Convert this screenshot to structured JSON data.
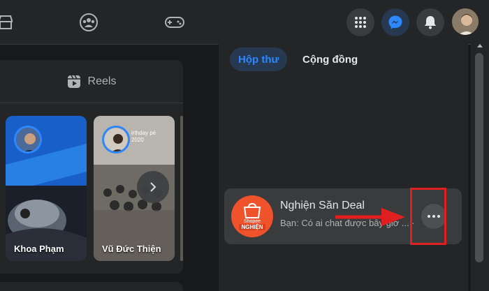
{
  "topbar": {
    "nav_icons": [
      "store-icon",
      "groups-icon",
      "gaming-icon"
    ],
    "right_buttons": [
      "menu-grid-icon",
      "messenger-icon",
      "notifications-icon"
    ]
  },
  "stories": {
    "reels_label": "Reels",
    "items": [
      {
        "name": "Khoa Phạm"
      },
      {
        "name": "Vũ Đức Thiện",
        "overlay_text": "irthday pé\n2020"
      }
    ]
  },
  "messenger": {
    "tabs": [
      {
        "label": "Hộp thư",
        "active": true
      },
      {
        "label": "Cộng đồng",
        "active": false
      }
    ],
    "conversation": {
      "title": "Nghiện Săn Deal",
      "preview": "Bạn: Có ai chat được bây giờ ... ·",
      "avatar_text": "NGHIỆN",
      "avatar_small": "Shopee"
    }
  },
  "colors": {
    "accent": "#2d88ff",
    "annotation": "#e02020",
    "avatar_bg": "#f0532c"
  }
}
